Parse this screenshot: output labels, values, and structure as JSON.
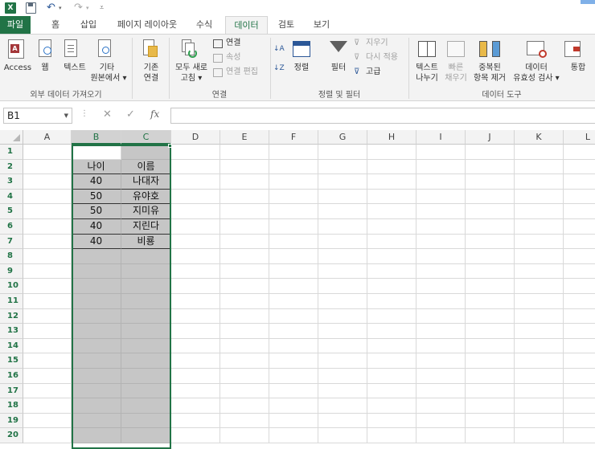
{
  "quick_access": {
    "logo": "X",
    "icons": [
      "excel-logo-icon",
      "save-icon",
      "undo-icon",
      "redo-icon",
      "customize-qat-icon"
    ]
  },
  "tabs": {
    "file": "파일",
    "home": "홈",
    "insert": "삽입",
    "page_layout": "페이지 레이아웃",
    "formulas": "수식",
    "data": "데이터",
    "review": "검토",
    "view": "보기"
  },
  "ribbon": {
    "external_data": {
      "access": "Access",
      "web": "웹",
      "text": "텍스트",
      "other_line1": "기타",
      "other_line2": "원본에서",
      "existing_line1": "기존",
      "existing_line2": "연결",
      "group_label": "외부 데이터 가져오기"
    },
    "connections": {
      "refresh_line1": "모두 새로",
      "refresh_line2": "고침",
      "connections": "연결",
      "properties": "속성",
      "edit_links": "연결 편집",
      "group_label": "연결"
    },
    "sort_filter": {
      "sort": "정렬",
      "filter": "필터",
      "clear": "지우기",
      "reapply": "다시 적용",
      "advanced": "고급",
      "group_label": "정렬 및 필터"
    },
    "data_tools": {
      "text_to_columns_line1": "텍스트",
      "text_to_columns_line2": "나누기",
      "flash_fill_line1": "빠른",
      "flash_fill_line2": "채우기",
      "remove_duplicates_line1": "중복된",
      "remove_duplicates_line2": "항목 제거",
      "validation_line1": "데이터",
      "validation_line2": "유효성 검사",
      "consolidate": "통합",
      "group_label": "데이터 도구"
    }
  },
  "formula_bar": {
    "name_box": "B1",
    "cancel": "✕",
    "enter": "✓",
    "fx": "fx",
    "formula": ""
  },
  "grid": {
    "columns": [
      "A",
      "B",
      "C",
      "D",
      "E",
      "F",
      "G",
      "H",
      "I",
      "J",
      "K",
      "L"
    ],
    "rows": [
      "1",
      "2",
      "3",
      "4",
      "5",
      "6",
      "7",
      "8",
      "9",
      "10",
      "11",
      "12",
      "13",
      "14",
      "15",
      "16",
      "17",
      "18",
      "19",
      "20"
    ],
    "table": {
      "header": [
        "나이",
        "이름"
      ],
      "rows": [
        [
          "40",
          "나대자"
        ],
        [
          "50",
          "유야호"
        ],
        [
          "50",
          "지미유"
        ],
        [
          "40",
          "지린다"
        ],
        [
          "40",
          "비룡"
        ]
      ]
    }
  }
}
